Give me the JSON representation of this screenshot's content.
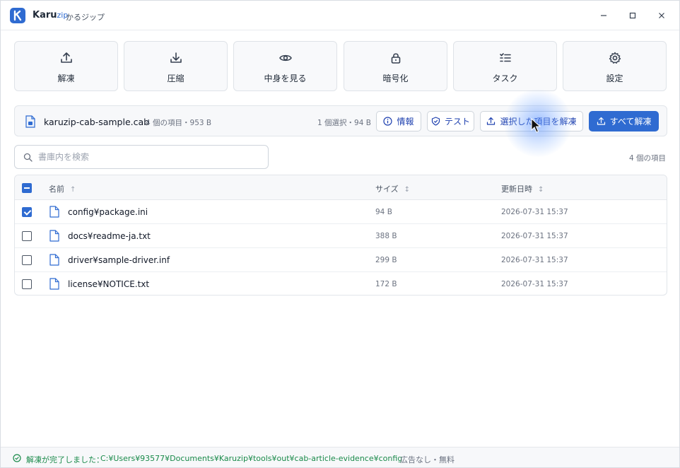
{
  "app": {
    "name": "Karu",
    "name_suffix": "zip",
    "subtitle": "かるジップ",
    "accent_color": "#2f6bd1"
  },
  "window_controls": {
    "minimize_icon": "minimize-icon",
    "maximize_icon": "maximize-icon",
    "close_icon": "close-icon"
  },
  "toolbar": {
    "items": [
      {
        "label": "解凍",
        "icon": "upload-tray-icon"
      },
      {
        "label": "圧縮",
        "icon": "download-tray-icon"
      },
      {
        "label": "中身を見る",
        "icon": "eye-icon"
      },
      {
        "label": "暗号化",
        "icon": "lock-icon"
      },
      {
        "label": "タスク",
        "icon": "task-list-icon"
      },
      {
        "label": "設定",
        "icon": "gear-icon"
      }
    ]
  },
  "archive": {
    "file_name": "karuzip-cab-sample.cab",
    "meta": "4 個の項目・953 B",
    "selection": "1 個選択・94 B",
    "buttons": {
      "info": "情報",
      "test": "テスト",
      "extract_selected": "選択した項目を解凍",
      "extract_all": "すべて解凍"
    }
  },
  "search": {
    "placeholder": "書庫内を検索",
    "value": ""
  },
  "item_count": "4 個の項目",
  "table": {
    "columns": {
      "name": "名前",
      "name_sort": "↑",
      "size": "サイズ",
      "size_sort": "↕",
      "modified": "更新日時",
      "modified_sort": "↕"
    },
    "rows": [
      {
        "name": "config¥package.ini",
        "size": "94 B",
        "modified": "2026-07-31 15:37",
        "checked": true
      },
      {
        "name": "docs¥readme-ja.txt",
        "size": "388 B",
        "modified": "2026-07-31 15:37",
        "checked": false
      },
      {
        "name": "driver¥sample-driver.inf",
        "size": "299 B",
        "modified": "2026-07-31 15:37",
        "checked": false
      },
      {
        "name": "license¥NOTICE.txt",
        "size": "172 B",
        "modified": "2026-07-31 15:37",
        "checked": false
      }
    ]
  },
  "status": {
    "message": "解凍が完了しました：",
    "path": "C:¥Users¥93577¥Documents¥Karuzip¥tools¥out¥cab-article-evidence¥config",
    "separator": "·",
    "note": "広告なし・無料",
    "color": "#1a8a4a"
  }
}
